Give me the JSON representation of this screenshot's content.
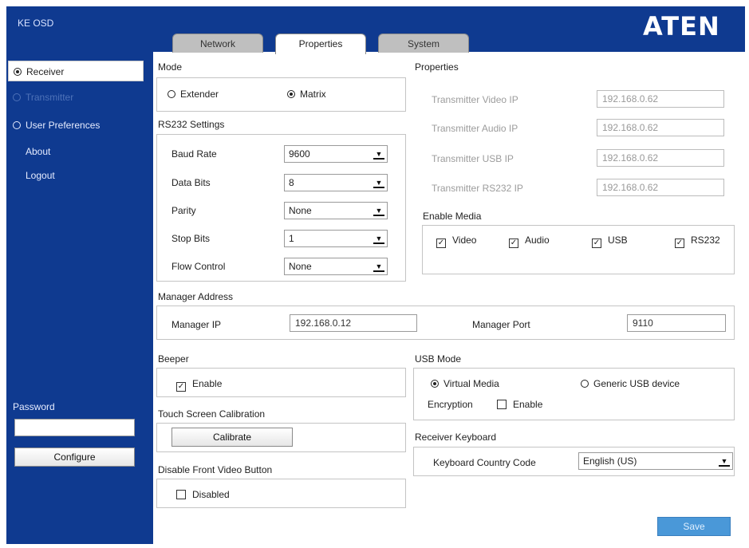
{
  "app": {
    "title": "KE OSD",
    "brand": "ATEN"
  },
  "tabs": [
    {
      "label": "Network",
      "active": false
    },
    {
      "label": "Properties",
      "active": true
    },
    {
      "label": "System",
      "active": false
    }
  ],
  "sidebar": {
    "items": [
      {
        "label": "Receiver",
        "type": "radio",
        "selected": true
      },
      {
        "label": "Transmitter",
        "type": "radio",
        "selected": false,
        "disabled": true
      },
      {
        "label": "User Preferences",
        "type": "radio",
        "selected": false
      },
      {
        "label": "About",
        "type": "link"
      },
      {
        "label": "Logout",
        "type": "link"
      }
    ],
    "password_label": "Password",
    "password_value": "",
    "configure_label": "Configure"
  },
  "mode": {
    "title": "Mode",
    "options": [
      {
        "label": "Extender",
        "selected": false
      },
      {
        "label": "Matrix",
        "selected": true
      }
    ]
  },
  "rs232": {
    "title": "RS232 Settings",
    "rows": [
      {
        "label": "Baud Rate",
        "value": "9600"
      },
      {
        "label": "Data Bits",
        "value": "8"
      },
      {
        "label": "Parity",
        "value": "None"
      },
      {
        "label": "Stop Bits",
        "value": "1"
      },
      {
        "label": "Flow Control",
        "value": "None"
      }
    ]
  },
  "properties": {
    "title": "Properties",
    "rows": [
      {
        "label": "Transmitter Video IP",
        "value": "192.168.0.62"
      },
      {
        "label": "Transmitter Audio IP",
        "value": "192.168.0.62"
      },
      {
        "label": "Transmitter USB IP",
        "value": "192.168.0.62"
      },
      {
        "label": "Transmitter RS232 IP",
        "value": "192.168.0.62"
      }
    ]
  },
  "enable_media": {
    "title": "Enable Media",
    "items": [
      {
        "label": "Video",
        "checked": true
      },
      {
        "label": "Audio",
        "checked": true
      },
      {
        "label": "USB",
        "checked": true
      },
      {
        "label": "RS232",
        "checked": true
      }
    ]
  },
  "manager": {
    "title": "Manager Address",
    "ip_label": "Manager IP",
    "ip_value": "192.168.0.12",
    "port_label": "Manager Port",
    "port_value": "9110"
  },
  "beeper": {
    "title": "Beeper",
    "enable_label": "Enable",
    "checked": true
  },
  "touch": {
    "title": "Touch Screen Calibration",
    "button_label": "Calibrate"
  },
  "front_video": {
    "title": "Disable Front Video Button",
    "label": "Disabled",
    "checked": false
  },
  "usb_mode": {
    "title": "USB Mode",
    "options": [
      {
        "label": "Virtual Media",
        "selected": true
      },
      {
        "label": "Generic USB device",
        "selected": false
      }
    ],
    "encryption_label": "Encryption",
    "encryption_enable_label": "Enable",
    "encryption_checked": false
  },
  "keyboard": {
    "title": "Receiver Keyboard",
    "label": "Keyboard Country Code",
    "value": "English (US)"
  },
  "save_label": "Save",
  "colors": {
    "brand_blue": "#0f3a90",
    "save_blue": "#4a98d8"
  },
  "icons": {
    "dropdown": "chevron-down-icon",
    "check": "checkmark-icon"
  }
}
